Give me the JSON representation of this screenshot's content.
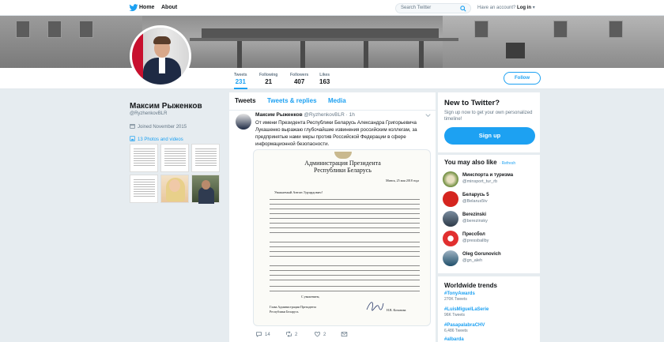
{
  "topnav": {
    "home_label": "Home",
    "about_label": "About",
    "search_placeholder": "Search Twitter",
    "account_prompt": "Have an account?",
    "login_label": "Log in"
  },
  "profile": {
    "name": "Максим Рыженков",
    "handle": "@RyzhenkovBLR",
    "joined": "Joined November 2015",
    "photos_label": "13 Photos and videos",
    "follow_label": "Follow",
    "stats": [
      {
        "label": "Tweets",
        "value": "231",
        "active": true
      },
      {
        "label": "Following",
        "value": "21"
      },
      {
        "label": "Followers",
        "value": "407"
      },
      {
        "label": "Likes",
        "value": "163"
      }
    ]
  },
  "timeline": {
    "tabs": [
      "Tweets",
      "Tweets & replies",
      "Media"
    ],
    "tweet": {
      "name": "Максим Рыженков",
      "handle": "@RyzhenkovBLR · 1h",
      "text": "От имени Президента Республики Беларусь Александра Григорьевича Лукашенко выражаю глубочайшие извинения российским коллегам, за предпринятые нами меры против Российской Федерации в сфере информационной безопасности.",
      "doc_title_1": "Администрация Президента",
      "doc_title_2": "Республики Беларусь",
      "doc_date": "Минск, 25 мая 2018 года",
      "doc_greeting": "Уважаемый Антон Эдуардович!",
      "doc_closing": "С уважением,",
      "doc_sig_title_1": "Глава Администрации Президента",
      "doc_sig_title_2": "Республики Беларусь",
      "doc_sig_name": "Н.В. Кочанова",
      "replies": "14",
      "retweets": "2",
      "likes": "2"
    }
  },
  "sidebar": {
    "new_title": "New to Twitter?",
    "new_desc": "Sign up now to get your own personalized timeline!",
    "signup_label": "Sign up",
    "ymal_title": "You may also like",
    "refresh_label": "· Refresh",
    "suggestions": [
      {
        "name": "Минспорта и туризма",
        "handle": "@minsport_tur_rb"
      },
      {
        "name": "Беларусь 5",
        "handle": "@Belarus5tv"
      },
      {
        "name": "Berezinski",
        "handle": "@berezinsky"
      },
      {
        "name": "Прессбол",
        "handle": "@pressballby"
      },
      {
        "name": "Oleg Gorunovich",
        "handle": "@gn_aleh"
      }
    ],
    "trends_title": "Worldwide trends",
    "trends": [
      {
        "tag": "#TonyAwards",
        "count": "270K Tweets"
      },
      {
        "tag": "#LuisMiguelLaSerie",
        "count": "96K Tweets"
      },
      {
        "tag": "#PasapalabraCHV",
        "count": "6,486 Tweets"
      },
      {
        "tag": "#albarda",
        "count": ""
      }
    ]
  },
  "colors": {
    "accent": "#1da1f2",
    "background": "#e6ecf0"
  }
}
